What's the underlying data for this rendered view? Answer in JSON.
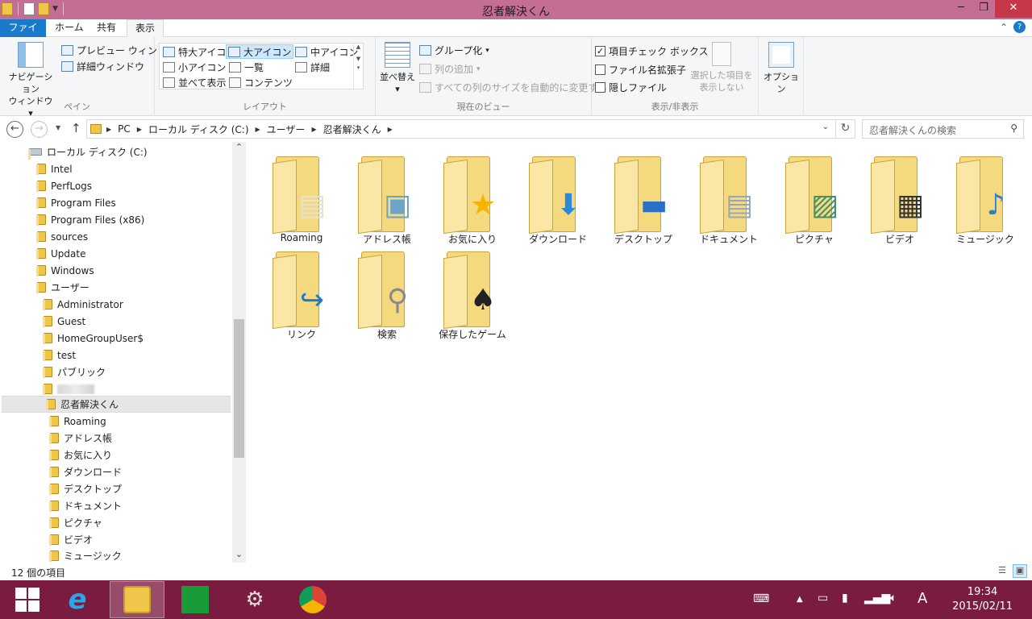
{
  "window": {
    "title": "忍者解決くん"
  },
  "ribbon_tabs": [
    "ファイル",
    "ホーム",
    "共有",
    "表示"
  ],
  "ribbon": {
    "pane": {
      "nav_pane_line1": "ナビゲーション",
      "nav_pane_line2": "ウィンドウ",
      "preview": "プレビュー ウィンドウ",
      "details": "詳細ウィンドウ",
      "label": "ペイン"
    },
    "layout": {
      "items": [
        "特大アイコン",
        "大アイコン",
        "中アイコン",
        "小アイコン",
        "一覧",
        "詳細",
        "並べて表示",
        "コンテンツ"
      ],
      "label": "レイアウト"
    },
    "current_view": {
      "sort_line1": "並べ替え",
      "group_by": "グループ化",
      "add_column": "列の追加",
      "size_all": "すべての列のサイズを自動的に変更する",
      "label": "現在のビュー"
    },
    "show_hide": {
      "item_checkboxes": "項目チェック ボックス",
      "file_extensions": "ファイル名拡張子",
      "hidden_items": "隠しファイル",
      "hide_selected_line1": "選択した項目を",
      "hide_selected_line2": "表示しない",
      "label": "表示/非表示"
    },
    "options": "オプション"
  },
  "address": {
    "crumbs": [
      "PC",
      "ローカル ディスク (C:)",
      "ユーザー",
      "忍者解決くん"
    ],
    "search_placeholder": "忍者解決くんの検索"
  },
  "nav_tree": {
    "drive": "ローカル ディスク (C:)",
    "top": [
      "Intel",
      "PerfLogs",
      "Program Files",
      "Program Files (x86)",
      "sources",
      "Update",
      "Windows",
      "ユーザー"
    ],
    "users": [
      "Administrator",
      "Guest",
      "HomeGroupUser$",
      "test",
      "パブリック"
    ],
    "current": "忍者解決くん",
    "children": [
      "Roaming",
      "アドレス帳",
      "お気に入り",
      "ダウンロード",
      "デスクトップ",
      "ドキュメント",
      "ピクチャ",
      "ビデオ",
      "ミュージック"
    ]
  },
  "folders": [
    {
      "name": "Roaming",
      "icon": "pages-icon"
    },
    {
      "name": "アドレス帳",
      "icon": "contact-card-icon"
    },
    {
      "name": "お気に入り",
      "icon": "star-icon"
    },
    {
      "name": "ダウンロード",
      "icon": "down-arrow-icon"
    },
    {
      "name": "デスクトップ",
      "icon": "monitor-icon"
    },
    {
      "name": "ドキュメント",
      "icon": "document-icon"
    },
    {
      "name": "ピクチャ",
      "icon": "picture-icon"
    },
    {
      "name": "ビデオ",
      "icon": "film-icon"
    },
    {
      "name": "ミュージック",
      "icon": "music-note-icon"
    },
    {
      "name": "リンク",
      "icon": "link-arrow-icon"
    },
    {
      "name": "検索",
      "icon": "magnifier-icon"
    },
    {
      "name": "保存したゲーム",
      "icon": "chess-icon"
    }
  ],
  "status": {
    "count": "12 個の項目"
  },
  "taskbar": {
    "time": "19:34",
    "date": "2015/02/11",
    "ime": "A"
  },
  "colors": {
    "titlebar": "#c46e95",
    "taskbar": "#7a1b40",
    "file_tab": "#1979ca",
    "folder": "#f5d97e"
  }
}
